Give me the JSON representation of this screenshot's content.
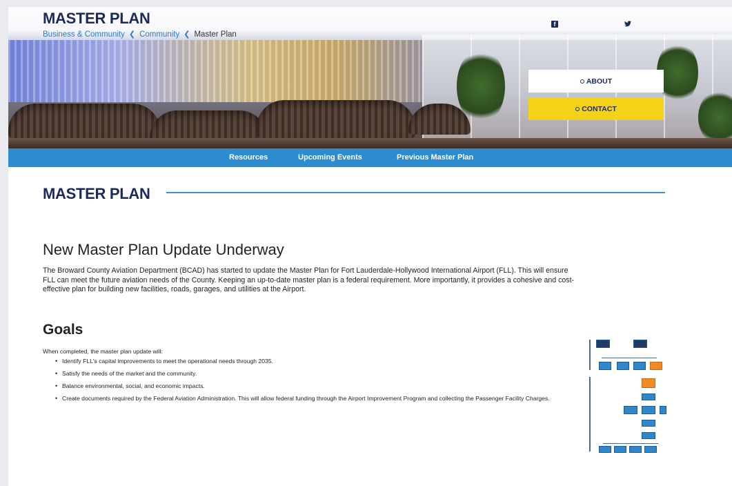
{
  "header": {
    "site_title": "MASTER PLAN",
    "breadcrumb": [
      "Business & Community",
      "Community",
      "Master Plan"
    ],
    "breadcrumb_separator": "<"
  },
  "social": {
    "facebook_glyph": "f",
    "twitter_glyph": "🐦"
  },
  "side_buttons": {
    "about_label": "ABOUT",
    "contact_label": "CONTACT"
  },
  "subnav": {
    "items": [
      "Resources",
      "Upcoming Events",
      "Previous Master Plan"
    ]
  },
  "main": {
    "section_title": "MASTER PLAN",
    "update_heading": "New Master Plan Update Underway",
    "update_paragraph": "The Broward County Aviation Department (BCAD) has started to update the Master Plan for Fort Lauderdale-Hollywood International Airport (FLL). This will ensure FLL can meet the future aviation needs of the County. Keeping an up-to-date master plan is a federal requirement. More importantly, it provides a cohesive and cost-effective plan for building new facilities, roads, garages, and utilities at the Airport.",
    "goals_heading": "Goals",
    "goals_lead": "When completed, the master plan update will:",
    "goals": [
      "Identify FLL's capital improvements to meet the operational needs through 2035.",
      "Satisfy the needs of the market and the community.",
      "Balance environmental, social, and economic impacts.",
      "Create documents required by the Federal Aviation Administration. This will allow federal funding through the Airport Improvement Program and collecting the Passenger Facility Charges."
    ]
  },
  "colors": {
    "brand_navy": "#1c2a5a",
    "nav_blue": "#2d8bd0",
    "link_blue": "#2b7ccf",
    "contact_yellow": "#f5d117",
    "chart_orange": "#f08a24"
  }
}
